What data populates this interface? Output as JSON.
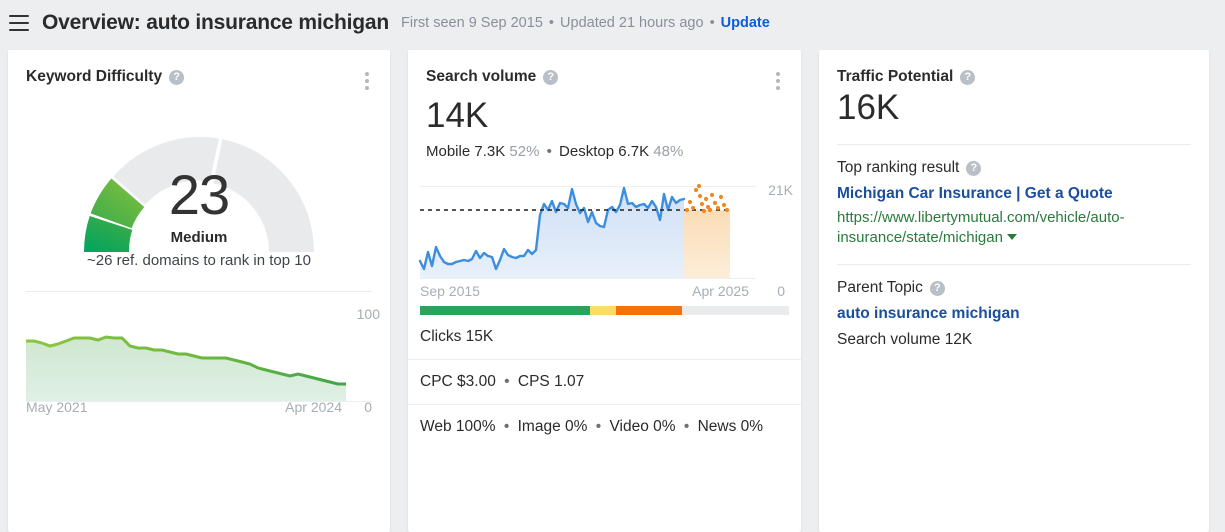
{
  "header": {
    "menu_icon": "hamburger-icon",
    "title": "Overview: auto insurance michigan",
    "first_seen": "First seen 9 Sep 2015",
    "updated": "Updated 21 hours ago",
    "update_label": "Update",
    "separator": "•"
  },
  "keyword_difficulty": {
    "title": "Keyword Difficulty",
    "help_icon": "question-mark-icon",
    "menu_icon": "kebab-menu-icon",
    "score": "23",
    "level": "Medium",
    "note": "~26 ref. domains to rank in top 10",
    "axis_max": "100",
    "axis_min": "0",
    "x_left": "May 2021",
    "x_right": "Apr 2024"
  },
  "search_volume": {
    "title": "Search volume",
    "help_icon": "question-mark-icon",
    "menu_icon": "kebab-menu-icon",
    "value": "14K",
    "mobile_label": "Mobile 7.3K",
    "mobile_pct": "52%",
    "desktop_label": "Desktop 6.7K",
    "desktop_pct": "48%",
    "axis_max": "21K",
    "axis_min": "0",
    "x_left": "Sep 2015",
    "x_right": "Apr 2025",
    "clicks": "Clicks 15K",
    "cpc": "CPC $3.00",
    "cps": "CPS 1.07",
    "web": "Web 100%",
    "image": "Image 0%",
    "video": "Video 0%",
    "news": "News 0%",
    "separator": "•"
  },
  "traffic_potential": {
    "title": "Traffic Potential",
    "help_icon": "question-mark-icon",
    "value": "16K",
    "top_ranking_label": "Top ranking result",
    "top_ranking_title": "Michigan Car Insurance | Get a Quote",
    "top_ranking_url": "https://www.libertymutual.com/vehicle/auto-insurance/state/michigan",
    "parent_topic_label": "Parent Topic",
    "parent_topic": "auto insurance michigan",
    "parent_topic_volume": "Search volume 12K"
  },
  "colors": {
    "accent_link": "#0b5ed7",
    "serp_link": "#1a4fa0",
    "url_green": "#2a7a3c",
    "gauge_green_light": "#63b243",
    "gauge_green_dark": "#04a05a",
    "gauge_track": "#e8eaec",
    "volume_line": "#3c8ede",
    "forecast_orange": "#f08a1e",
    "clicks_green": "#2aa45c",
    "clicks_yellow": "#f8dd6a",
    "clicks_orange": "#f4720b",
    "clicks_grey": "#e9ebed",
    "kd_line_start": "#8cc63f",
    "kd_line_end": "#3ea548"
  },
  "chart_data": [
    {
      "type": "gauge",
      "title": "Keyword Difficulty",
      "value": 23,
      "min": 0,
      "max": 100,
      "label": "Medium",
      "segments": 4,
      "filled_segments": 2,
      "annotation": "~26 ref. domains to rank in top 10"
    },
    {
      "type": "area",
      "title": "Keyword Difficulty history",
      "xlabel": "",
      "ylabel": "",
      "ylim": [
        0,
        100
      ],
      "x": [
        "May 2021",
        "Apr 2024"
      ],
      "tick_labels": [
        "May 2021",
        "Apr 2024"
      ],
      "grid": false,
      "series": [
        {
          "name": "Keyword Difficulty",
          "values": [
            52,
            52,
            51,
            50,
            51,
            52,
            53,
            53,
            53,
            52,
            53,
            53,
            53,
            50,
            49,
            49,
            48,
            48,
            47,
            46,
            46,
            45,
            44,
            44,
            44,
            44,
            43,
            42,
            41,
            39,
            38,
            37,
            36,
            35,
            36,
            35,
            34,
            33,
            32,
            31,
            31
          ]
        }
      ]
    },
    {
      "type": "area",
      "title": "Search volume history",
      "xlabel": "",
      "ylabel": "",
      "ylim": [
        0,
        21000
      ],
      "tick_labels": [
        "Sep 2015",
        "Apr 2025"
      ],
      "axis_max_label": "21K",
      "axis_min_label": "0",
      "average_line": 13500,
      "grid": false,
      "series": [
        {
          "name": "Search volume",
          "values": [
            3600,
            2200,
            4100,
            2700,
            4600,
            3600,
            2900,
            2700,
            2700,
            2900,
            3000,
            3100,
            3000,
            3200,
            4100,
            3300,
            3900,
            3500,
            3400,
            2200,
            3100,
            4400,
            3600,
            3400,
            3300,
            3500,
            3500,
            4300,
            3800,
            4300,
            10500,
            13400,
            11600,
            14200,
            11300,
            13900,
            13500,
            12300,
            19300,
            13400,
            11100,
            12700,
            9400,
            11800,
            9100,
            8500,
            8300,
            12000,
            12900,
            11300,
            13200,
            19800,
            13400,
            13900,
            12500,
            12900,
            13400,
            12300,
            14200,
            12700,
            9800,
            17300,
            12300,
            16400,
            14200,
            15400,
            15700
          ]
        },
        {
          "name": "Forecast",
          "values": [
            13500,
            16500,
            14000,
            19600,
            17500,
            13900,
            15900,
            13600,
            17800,
            14100,
            13500,
            16900,
            15200,
            14300,
            16600,
            15100
          ]
        }
      ]
    },
    {
      "type": "bar",
      "title": "Clicks distribution",
      "categories": [
        "organic",
        "paid-mixed",
        "paid",
        "no-click"
      ],
      "values": [
        46,
        8,
        19,
        27
      ],
      "ylabel": "percent",
      "ylim": [
        0,
        100
      ]
    }
  ]
}
